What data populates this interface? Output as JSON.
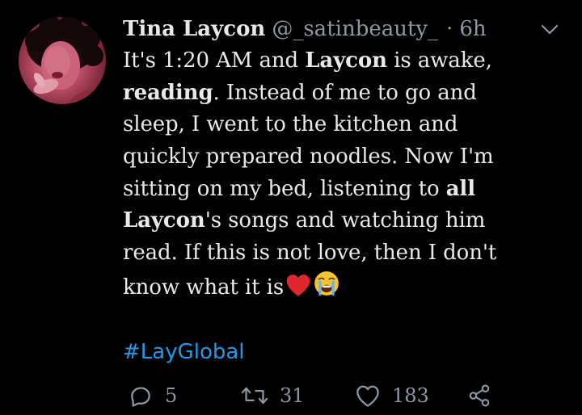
{
  "tweet": {
    "author": {
      "display_name": "Tina Laycon",
      "handle": "@_satinbeauty_",
      "separator": "·",
      "time": "6h"
    },
    "more_icon": "chevron-down-icon",
    "body_lines": [
      [
        {
          "t": "It's 1:20 AM and ",
          "b": false
        },
        {
          "t": "Laycon",
          "b": true
        },
        {
          "t": " is awake,",
          "b": false
        }
      ],
      [
        {
          "t": "reading",
          "b": true
        },
        {
          "t": ". Instead of me to go and",
          "b": false
        }
      ],
      [
        {
          "t": "sleep, I went to the kitchen and",
          "b": false
        }
      ],
      [
        {
          "t": "quickly prepared noodles. Now I'm",
          "b": false
        }
      ],
      [
        {
          "t": "sitting on my bed, listening to ",
          "b": false
        },
        {
          "t": "all",
          "b": true
        }
      ],
      [
        {
          "t": "Laycon",
          "b": true
        },
        {
          "t": "'s songs and watching him",
          "b": false
        }
      ],
      [
        {
          "t": "read. If this is not love, then I don't",
          "b": false
        }
      ],
      [
        {
          "t": "know what it is",
          "b": false
        }
      ]
    ],
    "trailing_emojis": [
      "red-heart-emoji",
      "loudly-crying-face-emoji"
    ],
    "hashtag": "#LayGlobal",
    "actions": {
      "reply": {
        "icon": "reply-icon",
        "count": "5"
      },
      "retweet": {
        "icon": "retweet-icon",
        "count": "31"
      },
      "like": {
        "icon": "heart-icon",
        "count": "183"
      },
      "share": {
        "icon": "share-icon"
      }
    },
    "colors": {
      "background": "#000000",
      "text": "#e7e9ea",
      "secondary": "#8b98a5",
      "link": "#1d9bf0"
    }
  }
}
